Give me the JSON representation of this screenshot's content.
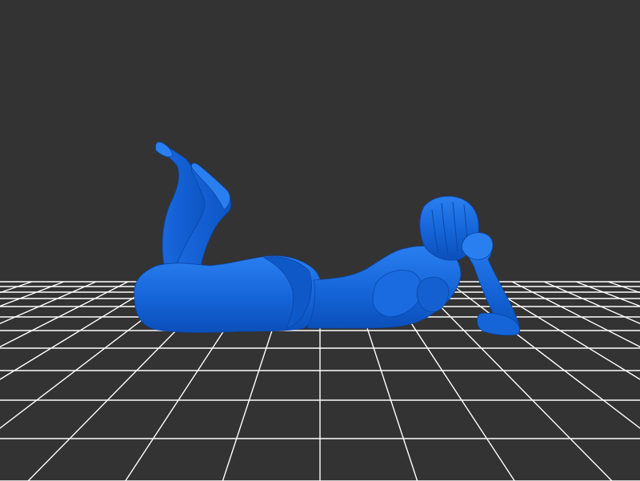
{
  "viewer": {
    "background_color": "#333333",
    "grid_color": "#ffffff",
    "grid_visible": true,
    "model_color": "#1565d8",
    "model_shade_color": "#0a4db8",
    "model_highlight_color": "#2b80f0",
    "model_subject": "reclining-figure-model"
  }
}
